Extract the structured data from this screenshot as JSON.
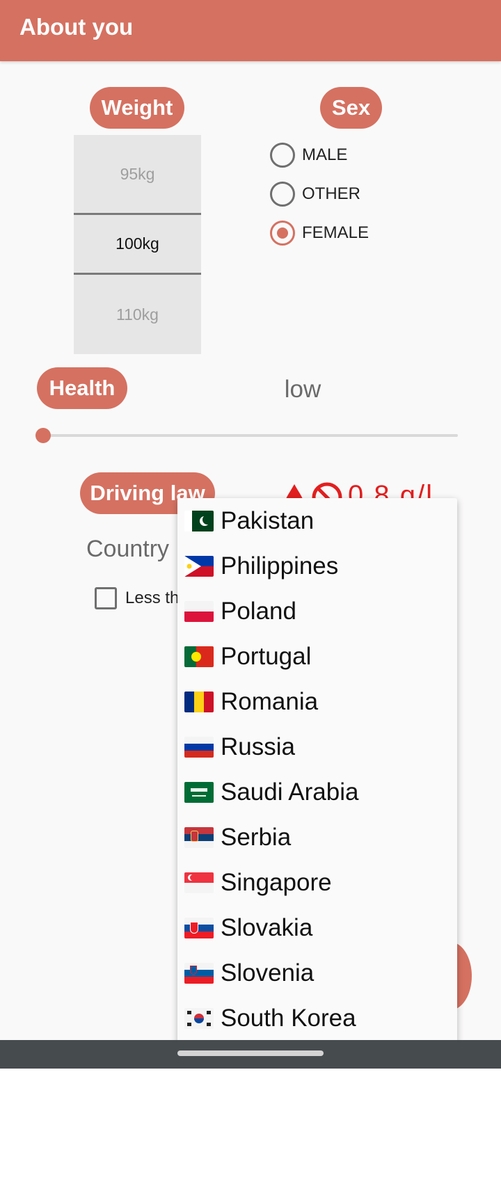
{
  "appbar": {
    "title": "About you"
  },
  "weight": {
    "label": "Weight",
    "options": [
      "95kg",
      "100kg",
      "110kg"
    ],
    "selected": "100kg"
  },
  "sex": {
    "label": "Sex",
    "options": [
      {
        "label": "MALE",
        "checked": false
      },
      {
        "label": "OTHER",
        "checked": false
      },
      {
        "label": "FEMALE",
        "checked": true
      }
    ]
  },
  "health": {
    "label": "Health",
    "value": "low",
    "slider_level": 0
  },
  "driving_law": {
    "label": "Driving law",
    "limit": "0.8 g/l",
    "icons": [
      "blood-drop-icon",
      "no-entry-icon"
    ],
    "limit_color": "#e21f1f"
  },
  "country": {
    "label": "Country"
  },
  "checkbox": {
    "label": "Less th",
    "checked": false
  },
  "country_dropdown": {
    "items": [
      {
        "name": "Pakistan",
        "flag": "pakistan-flag-icon"
      },
      {
        "name": "Philippines",
        "flag": "philippines-flag-icon"
      },
      {
        "name": "Poland",
        "flag": "poland-flag-icon"
      },
      {
        "name": "Portugal",
        "flag": "portugal-flag-icon"
      },
      {
        "name": "Romania",
        "flag": "romania-flag-icon"
      },
      {
        "name": "Russia",
        "flag": "russia-flag-icon"
      },
      {
        "name": "Saudi Arabia",
        "flag": "saudi-arabia-flag-icon"
      },
      {
        "name": "Serbia",
        "flag": "serbia-flag-icon"
      },
      {
        "name": "Singapore",
        "flag": "singapore-flag-icon"
      },
      {
        "name": "Slovakia",
        "flag": "slovakia-flag-icon"
      },
      {
        "name": "Slovenia",
        "flag": "slovenia-flag-icon"
      },
      {
        "name": "South Korea",
        "flag": "south-korea-flag-icon"
      }
    ]
  },
  "colors": {
    "accent": "#d57161",
    "background": "#faf9f9",
    "nav_bar": "#464b4e"
  }
}
